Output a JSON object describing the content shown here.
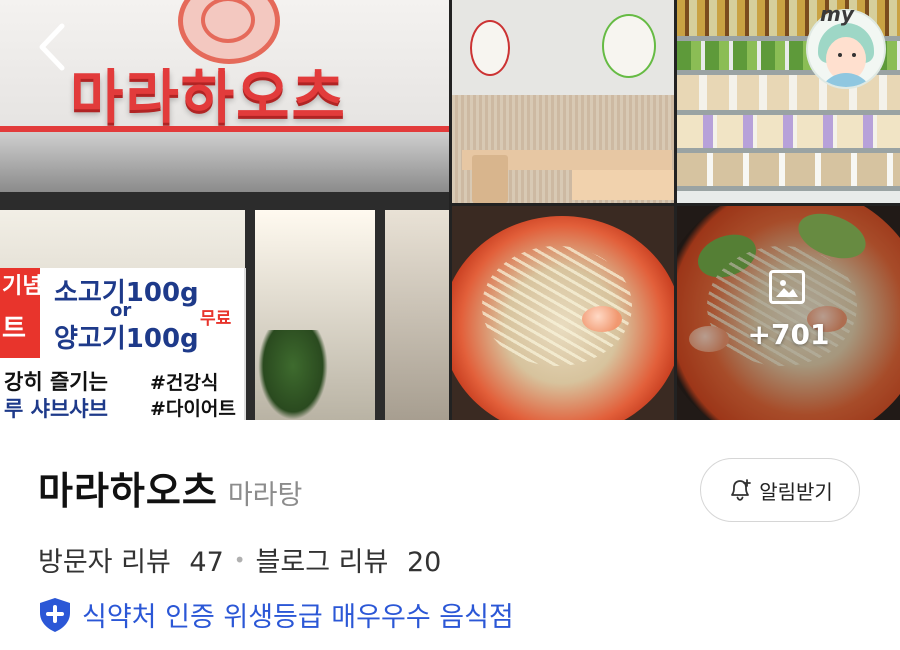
{
  "gallery": {
    "storefront_sign": "마라하오츠",
    "banner": {
      "left_top": "기념",
      "left_mid": "트",
      "line1": "소고기100g",
      "or": "or",
      "line2": "양고기100g",
      "free": "무료",
      "left_bottom1": "강히 즐기는",
      "left_bottom2": "루 샤브샤브",
      "tag1": "#건강식",
      "tag2": "#다이어트"
    },
    "avatar_text": "my",
    "more_count": "+701"
  },
  "place": {
    "name": "마라하오츠",
    "category": "마라탕",
    "alarm_label": "알림받기",
    "visitor_reviews_label": "방문자 리뷰",
    "visitor_reviews_count": "47",
    "blog_reviews_label": "블로그 리뷰",
    "blog_reviews_count": "20",
    "certification": "식약처 인증 위생등급 매우우수 음식점"
  },
  "colors": {
    "cert_blue": "#2b57d6",
    "sign_red": "#e23b3b"
  },
  "icons": {
    "back": "chevron-left-icon",
    "alarm": "bell-plus-icon",
    "photo": "image-icon",
    "certification": "shield-plus-icon"
  }
}
